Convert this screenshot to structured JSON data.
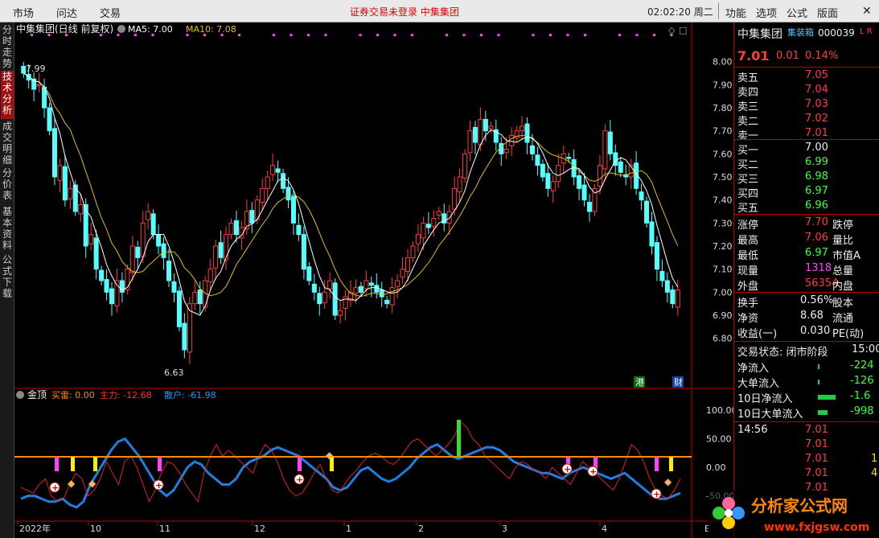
{
  "topbar": {
    "menus": [
      "市场",
      "问达",
      "交易"
    ],
    "notice": "证券交易未登录   中集集团",
    "time": "02:02:20 周二",
    "right_menus": [
      "功能",
      "选项",
      "公式",
      "版面"
    ]
  },
  "left_tabs": [
    "分时走势",
    "技术分析",
    "成交明细",
    "分价表",
    "基本资料",
    "公式下载"
  ],
  "main_chart": {
    "title": "中集集团(日线 前复权)",
    "ma5_label": "MA5: 7.00",
    "ma10_label": "MA10: 7.08",
    "high_mark": "7.99",
    "low_mark": "6.63",
    "badges": [
      "港",
      "财"
    ]
  },
  "indicator": {
    "name": "金顶",
    "buy_label": "买雷: 0.00",
    "main_label": "主力: -12.68",
    "retail_label": "散户: -61.98"
  },
  "x_axis": [
    "2022年",
    "10",
    "11",
    "12",
    "1",
    "2",
    "3",
    "4"
  ],
  "x_axis_tail": "E",
  "chart_data": {
    "type": "candlestick",
    "price_ylim": [
      6.6,
      8.1
    ],
    "price_ticks": [
      8.0,
      7.9,
      7.8,
      7.7,
      7.6,
      7.5,
      7.4,
      7.3,
      7.2,
      7.1,
      7.0,
      6.9,
      6.8
    ],
    "closes": [
      7.95,
      7.92,
      7.88,
      7.9,
      7.8,
      7.7,
      7.5,
      7.55,
      7.4,
      7.45,
      7.35,
      7.38,
      7.2,
      7.25,
      7.1,
      7.05,
      7.0,
      6.95,
      7.05,
      7.0,
      7.1,
      7.2,
      7.15,
      7.3,
      7.35,
      7.25,
      7.2,
      7.15,
      7.05,
      7.0,
      6.85,
      6.75,
      6.95,
      7.0,
      6.95,
      7.05,
      7.1,
      7.2,
      7.15,
      7.25,
      7.3,
      7.25,
      7.28,
      7.35,
      7.3,
      7.4,
      7.45,
      7.5,
      7.55,
      7.52,
      7.45,
      7.4,
      7.3,
      7.25,
      7.1,
      7.05,
      7.0,
      6.95,
      7.0,
      7.05,
      6.9,
      6.92,
      6.98,
      7.0,
      7.02,
      7.0,
      7.05,
      7.03,
      7.0,
      6.98,
      6.95,
      7.02,
      7.05,
      7.1,
      7.15,
      7.2,
      7.25,
      7.3,
      7.28,
      7.32,
      7.35,
      7.3,
      7.35,
      7.45,
      7.5,
      7.6,
      7.7,
      7.65,
      7.75,
      7.7,
      7.72,
      7.65,
      7.6,
      7.62,
      7.68,
      7.7,
      7.72,
      7.65,
      7.6,
      7.55,
      7.5,
      7.45,
      7.48,
      7.55,
      7.6,
      7.58,
      7.5,
      7.45,
      7.4,
      7.35,
      7.45,
      7.55,
      7.7,
      7.6,
      7.55,
      7.52,
      7.5,
      7.55,
      7.45,
      7.4,
      7.3,
      7.2,
      7.1,
      7.05,
      7.0,
      6.95,
      7.01
    ],
    "volume_ticks": [
      100.0,
      50.0,
      0.0,
      -50.0
    ],
    "main_force": [
      -35,
      -40,
      -45,
      -30,
      -20,
      -50,
      -60,
      -55,
      -30,
      -10,
      -20,
      -50,
      -40,
      -20,
      10,
      -10,
      -30,
      10,
      20,
      0,
      -30,
      -60,
      -40,
      -10,
      10,
      5,
      -10,
      -30,
      -45,
      -60,
      -10,
      20,
      40,
      20,
      30,
      20,
      10,
      0,
      -10,
      20,
      40,
      30,
      10,
      -20,
      -40,
      -50,
      -45,
      -30,
      -10,
      5,
      -20,
      -40,
      -45,
      -30,
      -15,
      -5,
      10,
      20,
      25,
      20,
      10,
      5,
      15,
      30,
      45,
      50,
      40,
      30,
      20,
      30,
      40,
      55,
      80,
      70,
      50,
      40,
      20,
      10,
      0,
      -10,
      -20,
      0,
      10,
      5,
      -5,
      -10,
      -20,
      0,
      -10,
      -20,
      -30,
      -10,
      10,
      0,
      -10,
      -20,
      -30,
      -40,
      -20,
      10,
      40,
      30,
      10,
      -20,
      -40,
      -50,
      -55,
      -40,
      -20
    ],
    "retail": [
      -55,
      -50,
      -50,
      -55,
      -60,
      -60,
      -55,
      -65,
      -70,
      -60,
      -30,
      -10,
      10,
      30,
      45,
      50,
      35,
      20,
      0,
      -20,
      -40,
      -50,
      -40,
      -20,
      0,
      10,
      5,
      -10,
      -20,
      -30,
      -30,
      -20,
      0,
      10,
      15,
      20,
      30,
      35,
      30,
      25,
      20,
      10,
      0,
      -10,
      -20,
      -35,
      -40,
      -35,
      -20,
      -5,
      0,
      -10,
      -20,
      -25,
      -20,
      -10,
      0,
      15,
      25,
      35,
      40,
      30,
      20,
      15,
      20,
      25,
      30,
      35,
      35,
      30,
      20,
      10,
      5,
      0,
      -5,
      -10,
      -10,
      -15,
      -20,
      -10,
      -5,
      0,
      -5,
      -10,
      -15,
      -20,
      -15,
      -10,
      -20,
      -30,
      -40,
      -50,
      -55,
      -55,
      -50,
      -45
    ],
    "signals": {
      "buy_thunder": [
        "+",
        "+",
        "+",
        "+",
        "+"
      ],
      "diamond": [
        "◆",
        "◆",
        "◆",
        "◆"
      ]
    }
  },
  "quote": {
    "name": "中集集团",
    "tag": "集装箱",
    "code": "000039",
    "flags": "L R",
    "price": "7.01",
    "change": "0.01",
    "pct": "0.14%",
    "asks": [
      {
        "label": "卖五",
        "price": "7.05"
      },
      {
        "label": "卖四",
        "price": "7.04"
      },
      {
        "label": "卖三",
        "price": "7.03"
      },
      {
        "label": "卖二",
        "price": "7.02"
      },
      {
        "label": "卖一",
        "price": "7.01"
      }
    ],
    "bids": [
      {
        "label": "买一",
        "price": "7.00"
      },
      {
        "label": "买二",
        "price": "6.99"
      },
      {
        "label": "买三",
        "price": "6.98"
      },
      {
        "label": "买四",
        "price": "6.97"
      },
      {
        "label": "买五",
        "price": "6.96"
      }
    ],
    "stats": [
      {
        "label": "涨停",
        "value": "7.70",
        "label2": "跌停"
      },
      {
        "label": "最高",
        "value": "7.06",
        "label2": "量比"
      },
      {
        "label": "最低",
        "value": "6.97",
        "label2": "市值A"
      },
      {
        "label": "现量",
        "value": "1318",
        "label2": "总量"
      },
      {
        "label": "外盘",
        "value": "56354",
        "label2": "内盘"
      }
    ],
    "fin": [
      {
        "label": "换手",
        "value": "0.56%",
        "label2": "股本"
      },
      {
        "label": "净资",
        "value": "8.68",
        "label2": "流通"
      },
      {
        "label": "收益(一)",
        "value": "0.030",
        "label2": "PE(动)"
      }
    ],
    "status_label": "交易状态: 闭市阶段",
    "status_time": "15:00",
    "flows": [
      {
        "label": "净流入",
        "value": "-224"
      },
      {
        "label": "大单流入",
        "value": "-126"
      },
      {
        "label": "10日净流入",
        "value": "-1.6"
      },
      {
        "label": "10日大单流入",
        "value": "-998"
      }
    ],
    "ticks_time": "14:56",
    "ticks": [
      "7.01",
      "7.01",
      "7.01",
      "7.01",
      "7.01"
    ],
    "ticks_vol": [
      "",
      "",
      "1",
      "4",
      ""
    ]
  },
  "watermark": {
    "text": "分析家公式网",
    "url": "www.fxjgsw.com"
  },
  "colors": {
    "up": "#ff3c3c",
    "down": "#54ffff",
    "ma5": "#ffffff",
    "ma10": "#e0c000",
    "blue": "#1e7fe0",
    "orange": "#ff8a00"
  }
}
